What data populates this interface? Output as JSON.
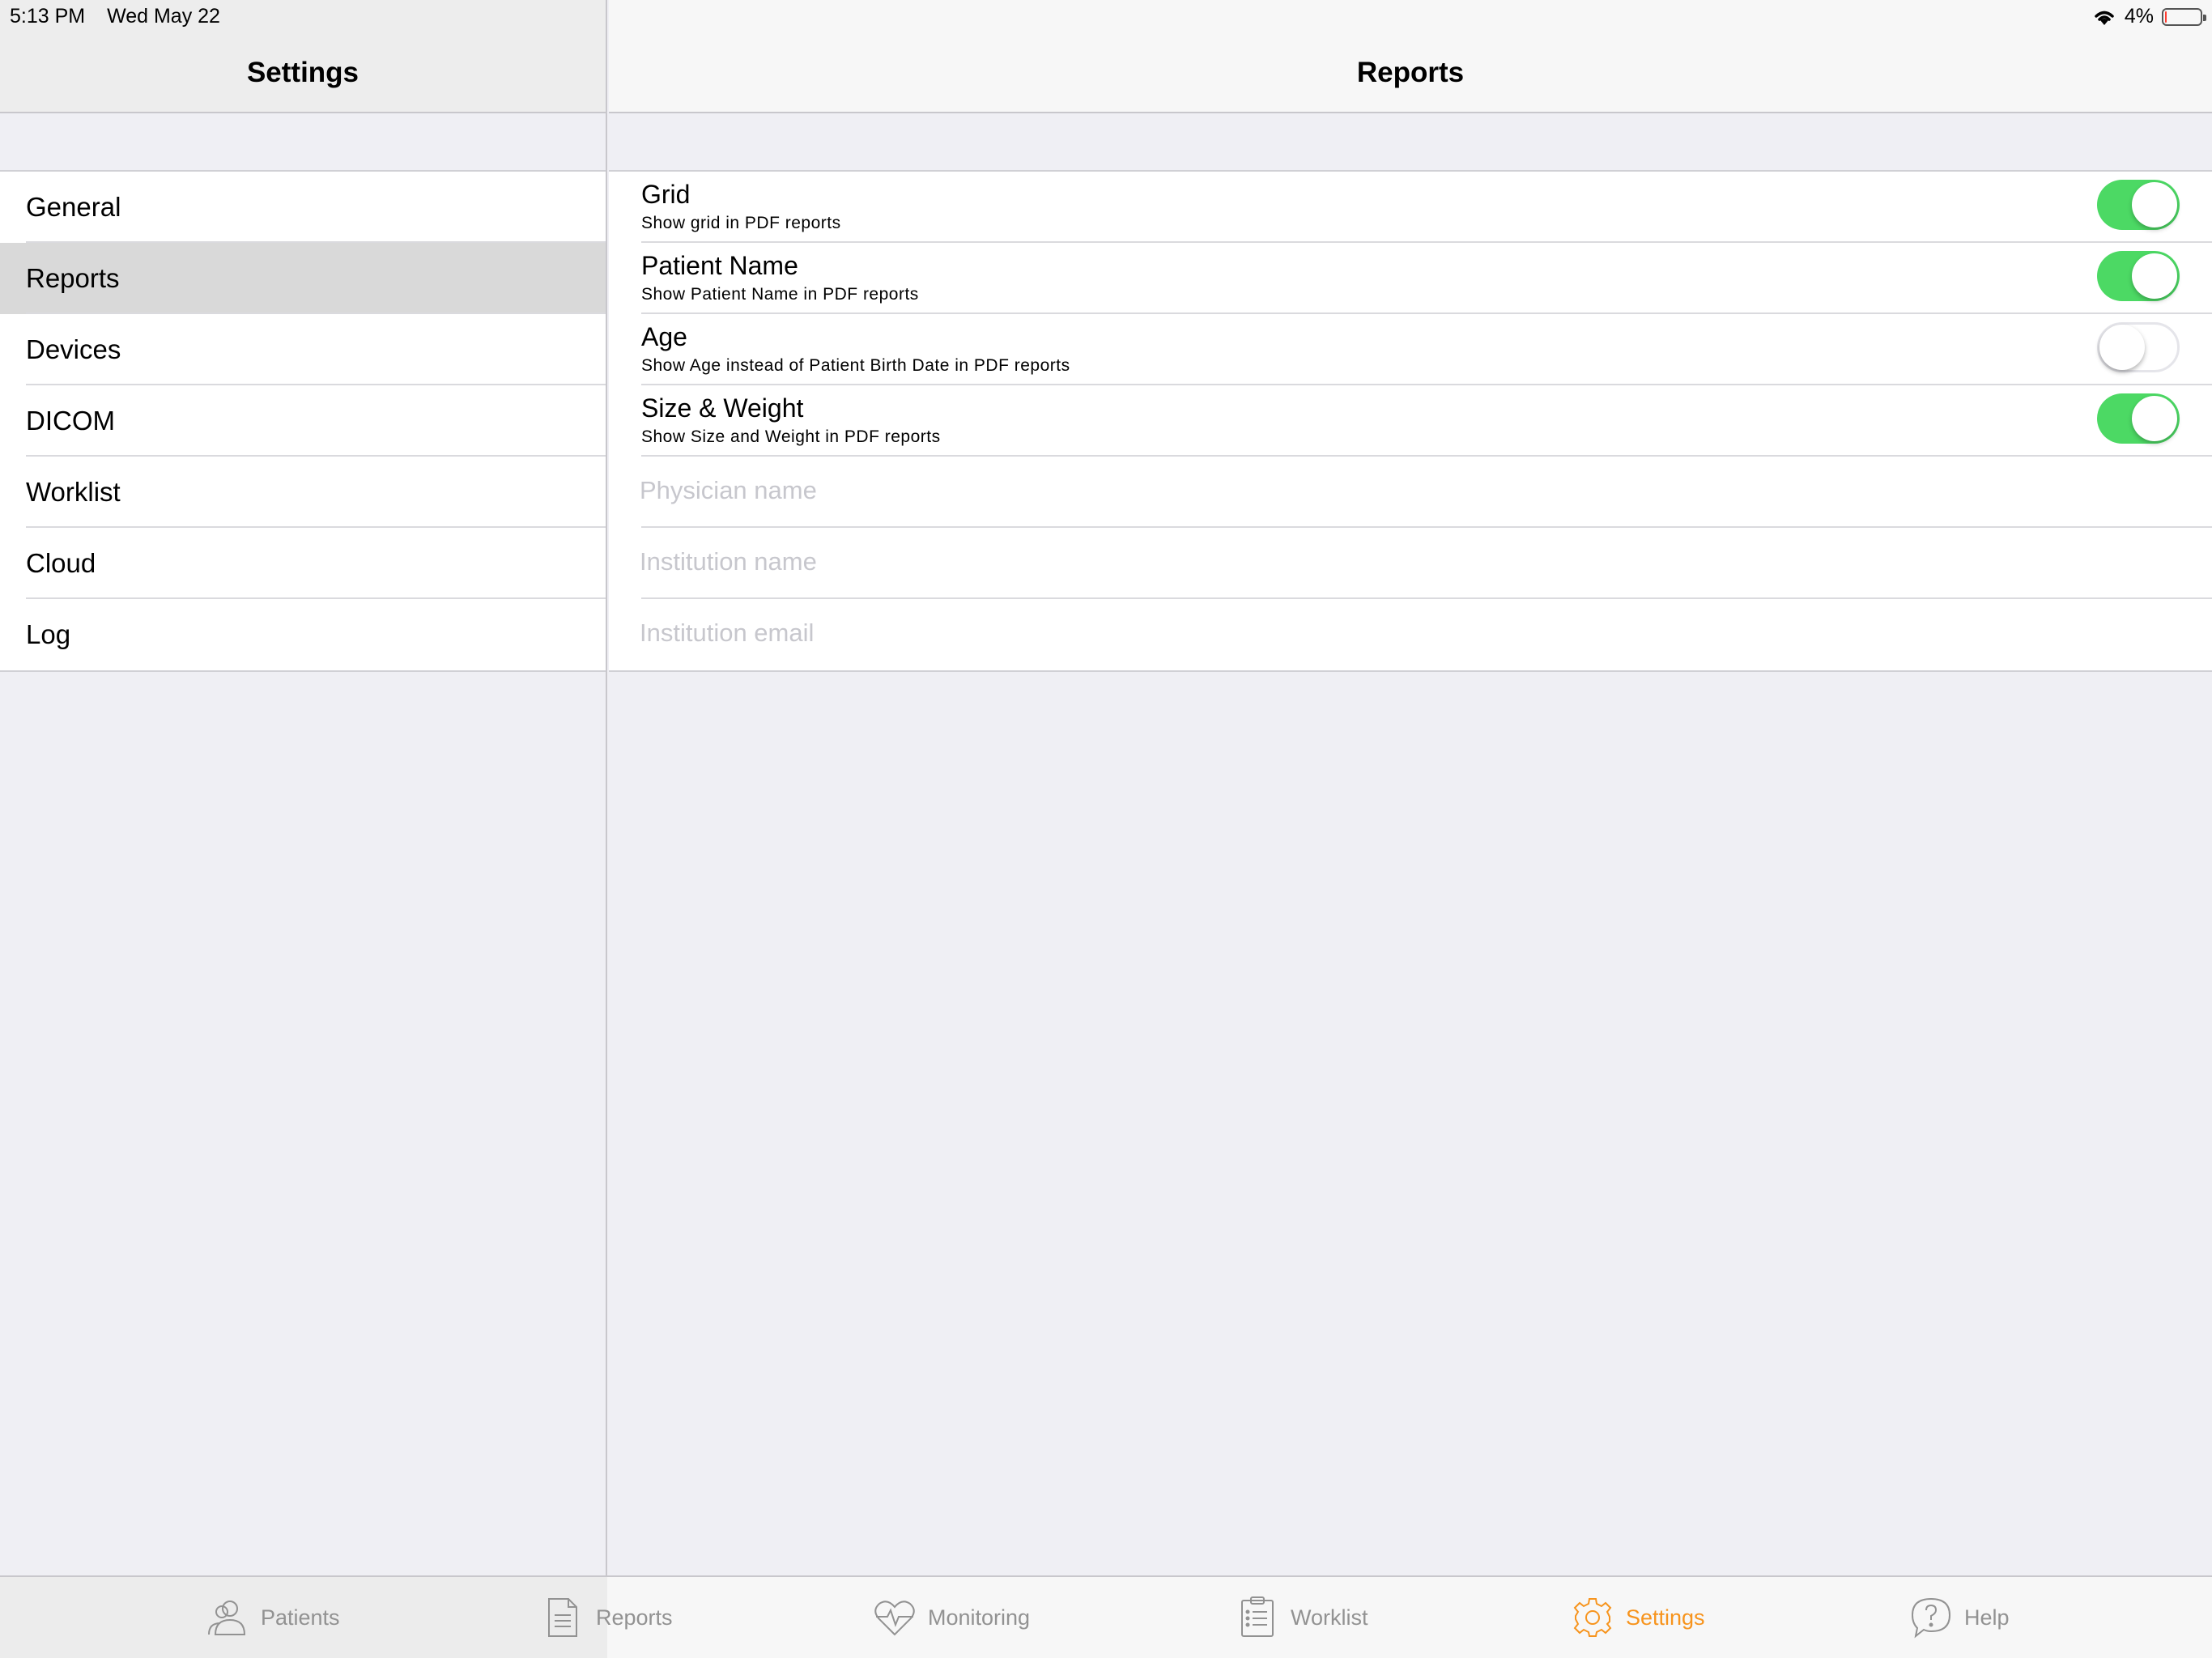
{
  "status_bar": {
    "time": "5:13 PM",
    "date": "Wed May 22",
    "battery": "4%"
  },
  "master": {
    "title": "Settings",
    "items": [
      {
        "label": "General"
      },
      {
        "label": "Reports",
        "selected": true
      },
      {
        "label": "Devices"
      },
      {
        "label": "DICOM"
      },
      {
        "label": "Worklist"
      },
      {
        "label": "Cloud"
      },
      {
        "label": "Log"
      }
    ]
  },
  "detail": {
    "title": "Reports",
    "toggles": [
      {
        "title": "Grid",
        "subtitle": "Show grid in PDF reports",
        "on": true
      },
      {
        "title": "Patient Name",
        "subtitle": "Show Patient Name in PDF reports",
        "on": true
      },
      {
        "title": "Age",
        "subtitle": "Show Age instead of Patient Birth Date in PDF reports",
        "on": false
      },
      {
        "title": "Size & Weight",
        "subtitle": "Show Size and Weight in PDF reports",
        "on": true
      }
    ],
    "fields": [
      {
        "placeholder": "Physician name",
        "value": ""
      },
      {
        "placeholder": "Institution name",
        "value": ""
      },
      {
        "placeholder": "Institution email",
        "value": ""
      }
    ]
  },
  "tabbar": {
    "tabs": [
      {
        "label": "Patients",
        "icon": "patients-icon"
      },
      {
        "label": "Reports",
        "icon": "reports-icon"
      },
      {
        "label": "Monitoring",
        "icon": "monitoring-icon"
      },
      {
        "label": "Worklist",
        "icon": "worklist-icon"
      },
      {
        "label": "Settings",
        "icon": "settings-icon",
        "active": true
      },
      {
        "label": "Help",
        "icon": "help-icon"
      }
    ]
  },
  "colors": {
    "accent": "#f7941d",
    "toggle_on": "#4cd964",
    "placeholder": "#c7c7cd"
  }
}
